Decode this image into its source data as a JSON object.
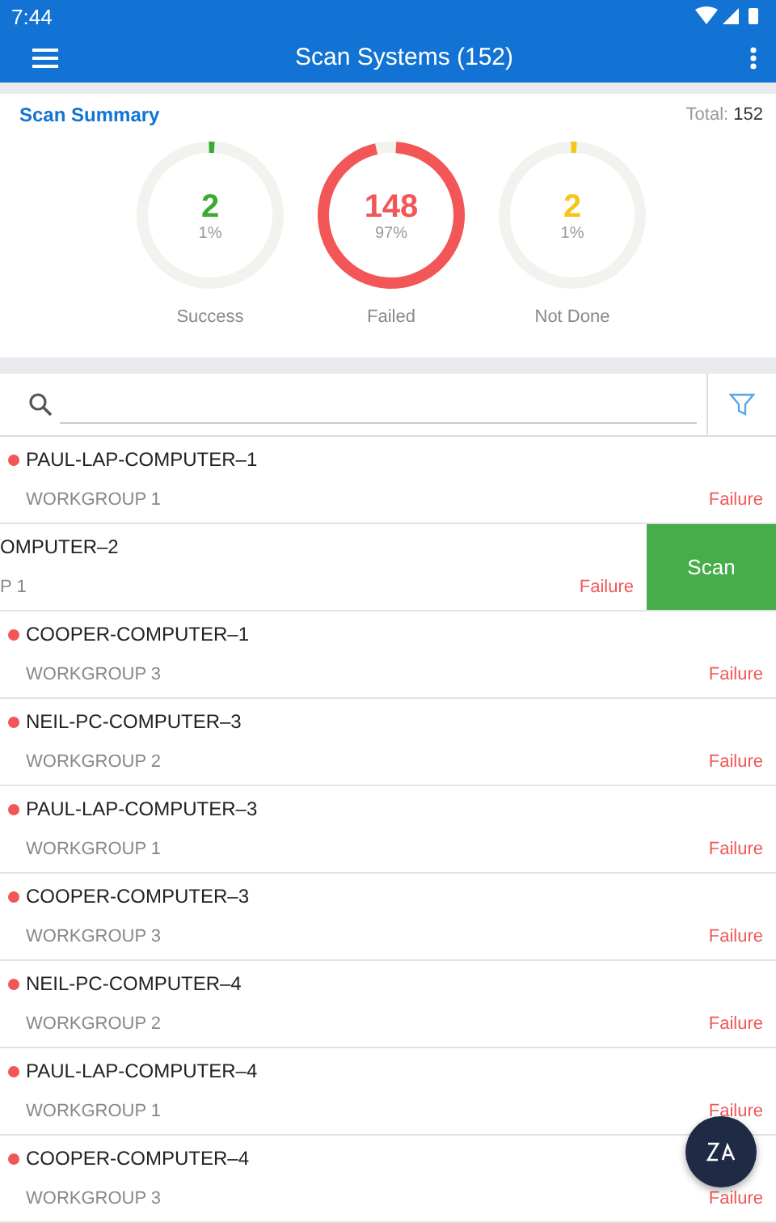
{
  "status_bar": {
    "time": "7:44"
  },
  "app_bar": {
    "title": "Scan Systems (152)"
  },
  "summary": {
    "title": "Scan Summary",
    "total_label": "Total:",
    "total": "152",
    "gauges": [
      {
        "count": "2",
        "percent": "1%",
        "label": "Success",
        "level": 0.013,
        "color": "#3aaa35"
      },
      {
        "count": "148",
        "percent": "97%",
        "label": "Failed",
        "level": 0.974,
        "color": "#f25656"
      },
      {
        "count": "2",
        "percent": "1%",
        "label": "Not Done",
        "level": 0.013,
        "color": "#f5c518"
      }
    ]
  },
  "systems": [
    {
      "kind": "normal",
      "name": "PAUL-LAP-COMPUTER–1",
      "group": "WORKGROUP 1",
      "status": "Failure"
    },
    {
      "kind": "swiped",
      "name": "OMPUTER–2",
      "group": "P 1",
      "status": "Failure",
      "action": "Scan"
    },
    {
      "kind": "normal",
      "name": "COOPER-COMPUTER–1",
      "group": "WORKGROUP 3",
      "status": "Failure"
    },
    {
      "kind": "normal",
      "name": "NEIL-PC-COMPUTER–3",
      "group": "WORKGROUP 2",
      "status": "Failure"
    },
    {
      "kind": "normal",
      "name": "PAUL-LAP-COMPUTER–3",
      "group": "WORKGROUP 1",
      "status": "Failure"
    },
    {
      "kind": "normal",
      "name": "COOPER-COMPUTER–3",
      "group": "WORKGROUP 3",
      "status": "Failure"
    },
    {
      "kind": "normal",
      "name": "NEIL-PC-COMPUTER–4",
      "group": "WORKGROUP 2",
      "status": "Failure"
    },
    {
      "kind": "normal",
      "name": "PAUL-LAP-COMPUTER–4",
      "group": "WORKGROUP 1",
      "status": "Failure"
    },
    {
      "kind": "normal",
      "name": "COOPER-COMPUTER–4",
      "group": "WORKGROUP 3",
      "status": "Failure"
    }
  ]
}
